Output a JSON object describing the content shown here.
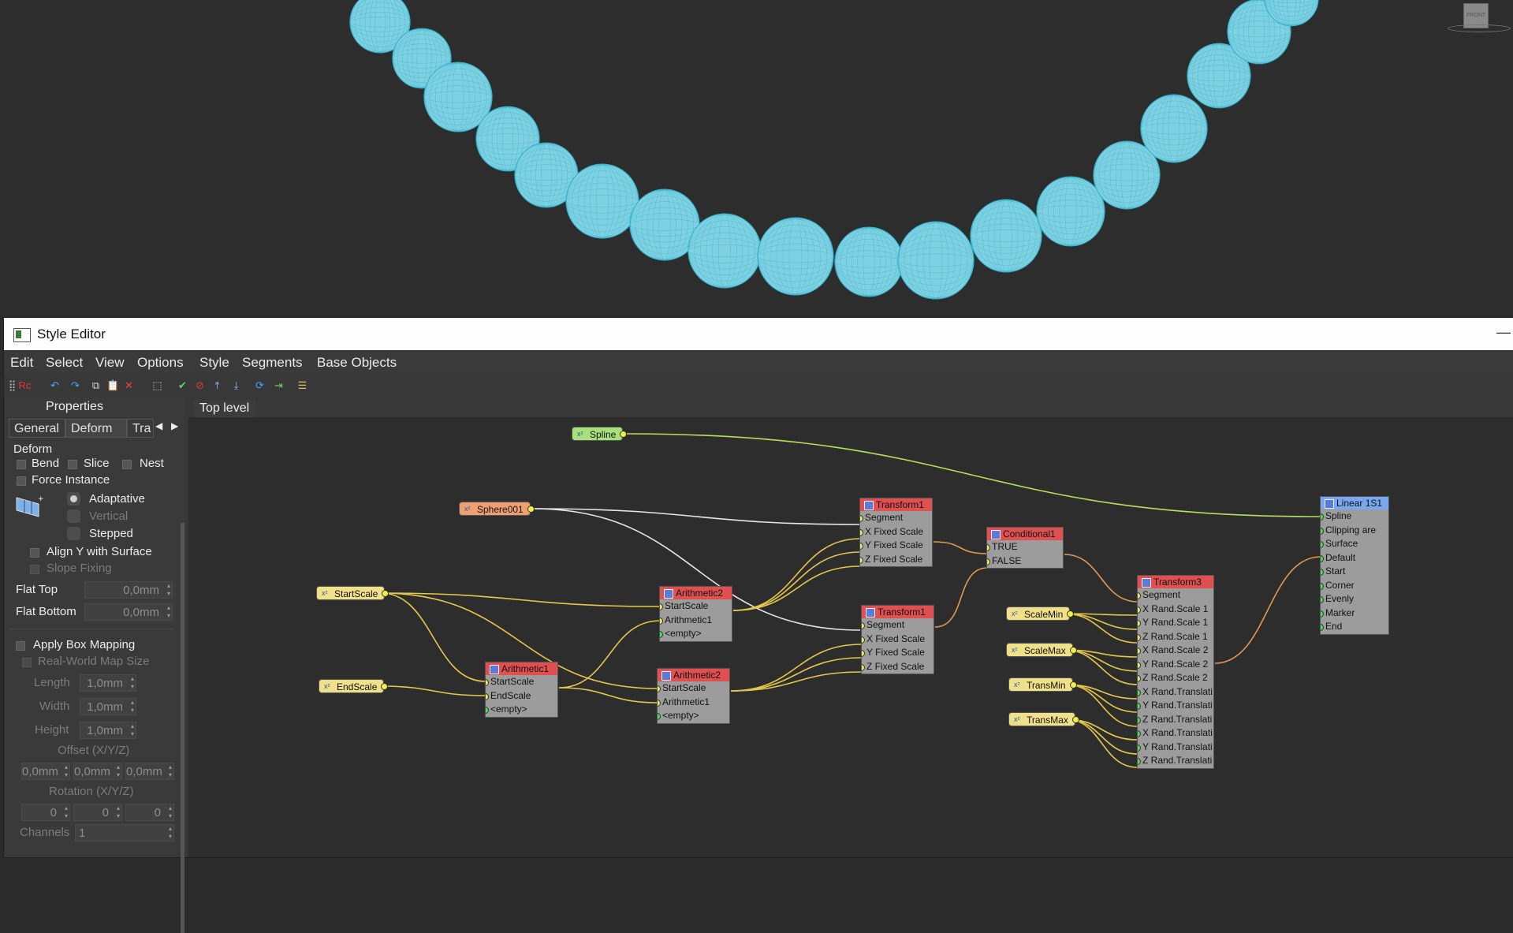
{
  "viewport": {
    "viewcube_label": "FRONT",
    "bead_color": "#7fd1e2",
    "wire_color": "#37b4cd",
    "background": "#2d2d2d"
  },
  "window": {
    "title": "Style Editor",
    "minimize": "—"
  },
  "menu": [
    "Edit",
    "Select",
    "View",
    "Options",
    "Style",
    "Segments",
    "Base Objects"
  ],
  "toolbar": [
    {
      "icon": "dotted-grid-icon",
      "glyph": "⣿",
      "color": "#bbbbbb"
    },
    {
      "icon": "railclone-logo-icon",
      "glyph": "Rc",
      "color": "#e53935"
    },
    {
      "icon": "undo-icon",
      "glyph": "↶",
      "color": "#4aa3ff"
    },
    {
      "icon": "redo-icon",
      "glyph": "↷",
      "color": "#4aa3ff"
    },
    {
      "icon": "copy-icon",
      "glyph": "⧉",
      "color": "#dddddd"
    },
    {
      "icon": "paste-icon",
      "glyph": "📋",
      "color": "#d4a055"
    },
    {
      "icon": "delete-icon",
      "glyph": "✕",
      "color": "#ff3b3b"
    },
    {
      "icon": "select-frame-icon",
      "glyph": "⬚",
      "color": "#cccccc"
    },
    {
      "icon": "enable-check-icon",
      "glyph": "✔",
      "color": "#5bd65b"
    },
    {
      "icon": "disable-icon",
      "glyph": "⊘",
      "color": "#e53935"
    },
    {
      "icon": "align-top-icon",
      "glyph": "⤒",
      "color": "#8fb8ff"
    },
    {
      "icon": "align-bottom-icon",
      "glyph": "⤓",
      "color": "#8fb8ff"
    },
    {
      "icon": "refresh-icon",
      "glyph": "⟳",
      "color": "#4aa3ff"
    },
    {
      "icon": "export-icon",
      "glyph": "⇥",
      "color": "#5bd65b"
    },
    {
      "icon": "list-icon",
      "glyph": "☰",
      "color": "#e0c060"
    }
  ],
  "properties": {
    "header": "Properties",
    "tabs": [
      "General",
      "Deform",
      "Tra"
    ],
    "section_deform": "Deform",
    "bend": "Bend",
    "slice": "Slice",
    "nest": "Nest",
    "force_instance": "Force Instance",
    "adaptative": "Adaptative",
    "vertical": "Vertical",
    "stepped": "Stepped",
    "align_y": "Align Y with Surface",
    "slope_fixing": "Slope Fixing",
    "flat_top": "Flat Top",
    "flat_top_value": "0,0mm",
    "flat_bottom": "Flat Bottom",
    "flat_bottom_value": "0,0mm",
    "apply_box": "Apply Box Mapping",
    "real_world": "Real-World Map Size",
    "length": "Length",
    "length_value": "1,0mm",
    "width": "Width",
    "width_value": "1,0mm",
    "height": "Height",
    "height_value": "1,0mm",
    "offset": "Offset (X/Y/Z)",
    "offset_values": [
      "0,0mm",
      "0,0mm",
      "0,0mm"
    ],
    "rotation": "Rotation (X/Y/Z)",
    "rotation_values": [
      "0",
      "0",
      "0"
    ],
    "channels": "Channels",
    "channels_value": "1"
  },
  "breadcrumb": "Top level",
  "graph": {
    "spline": "Spline",
    "sphere": "Sphere001",
    "start_scale": "StartScale",
    "end_scale": "EndScale",
    "scale_min": "ScaleMin",
    "scale_max": "ScaleMax",
    "trans_min": "TransMin",
    "trans_max": "TransMax",
    "arith1": {
      "title": "Arithmetic1",
      "ports": [
        "StartScale",
        "EndScale",
        "<empty>"
      ]
    },
    "arith2a": {
      "title": "Arithmetic2",
      "ports": [
        "StartScale",
        "Arithmetic1",
        "<empty>"
      ]
    },
    "arith2b": {
      "title": "Arithmetic2",
      "ports": [
        "StartScale",
        "Arithmetic1",
        "<empty>"
      ]
    },
    "transform1a": {
      "title": "Transform1",
      "ports": [
        "Segment",
        "X Fixed Scale",
        "Y Fixed Scale",
        "Z Fixed Scale"
      ]
    },
    "transform1b": {
      "title": "Transform1",
      "ports": [
        "Segment",
        "X Fixed Scale",
        "Y Fixed Scale",
        "Z Fixed Scale"
      ]
    },
    "conditional": {
      "title": "Conditional1",
      "ports": [
        "TRUE",
        "FALSE"
      ]
    },
    "transform3": {
      "title": "Transform3",
      "ports": [
        "Segment",
        "X Rand.Scale 1",
        "Y Rand.Scale 1",
        "Z Rand.Scale 1",
        "X Rand.Scale 2",
        "Y Rand.Scale 2",
        "Z Rand.Scale 2",
        "X Rand.Translati",
        "Y Rand.Translati",
        "Z Rand.Translati",
        "X Rand.Translati",
        "Y Rand.Translati",
        "Z Rand.Translati"
      ]
    },
    "linear": {
      "title": "Linear 1S1",
      "ports": [
        "Spline",
        "Clipping are",
        "Surface",
        "Default",
        "Start",
        "Corner",
        "Evenly",
        "Marker",
        "End"
      ]
    },
    "colors": {
      "spline": "#a8e07a",
      "sphere": "#f0a070",
      "param": "#f0e08a",
      "node_header": "#e05050",
      "linear_header": "#7aa8f0"
    }
  }
}
